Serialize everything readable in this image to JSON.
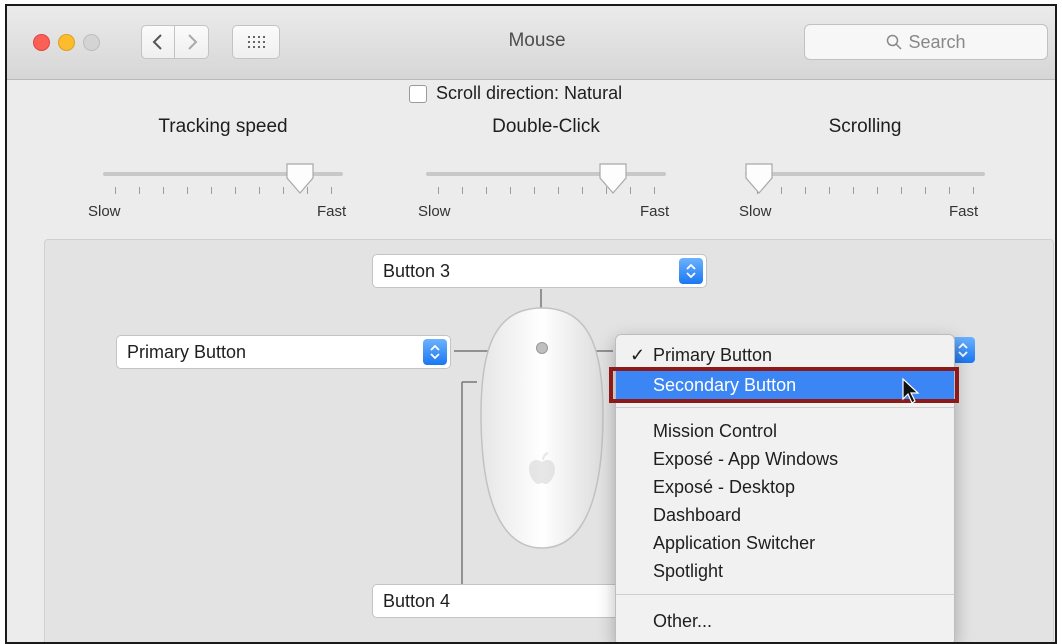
{
  "window": {
    "title": "Mouse"
  },
  "search": {
    "placeholder": "Search"
  },
  "scroll_direction": {
    "label": "Scroll direction: Natural",
    "checked": false
  },
  "sliders": [
    {
      "label": "Tracking speed",
      "min_label": "Slow",
      "max_label": "Fast",
      "value_fraction": 0.82
    },
    {
      "label": "Double-Click",
      "min_label": "Slow",
      "max_label": "Fast",
      "value_fraction": 0.78
    },
    {
      "label": "Scrolling",
      "min_label": "Slow",
      "max_label": "Fast",
      "value_fraction": 0.06
    }
  ],
  "popups": {
    "top": "Button 3",
    "left": "Primary Button",
    "bottom": "Button 4"
  },
  "menu": {
    "items": [
      "Primary Button",
      "Secondary Button",
      "Mission Control",
      "Exposé - App Windows",
      "Exposé - Desktop",
      "Dashboard",
      "Application Switcher",
      "Spotlight",
      "Other..."
    ],
    "checked_index": 0,
    "highlighted_index": 1,
    "check_glyph": "✓"
  },
  "colors": {
    "accent": "#3b86f4",
    "annotation": "#8c1a1a"
  }
}
